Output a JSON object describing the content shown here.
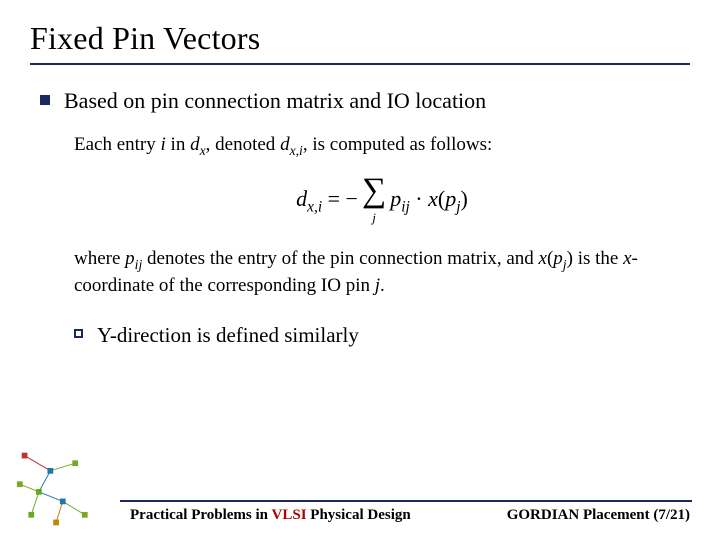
{
  "title": "Fixed Pin Vectors",
  "bullet1": "Based on pin connection matrix and IO location",
  "math": {
    "preline_a": "Each entry ",
    "i": "i",
    "preline_b": " in ",
    "dx": "d",
    "x": "x",
    "preline_c": ", denoted ",
    "dxi": "d",
    "xi": "x,i",
    "preline_d": ", is computed as follows:",
    "lhs_d": "d",
    "lhs_sub": "x,i",
    "eq": " = −",
    "sum_lower": "j",
    "p": "p",
    "ij": "ij",
    "cdot": " · ",
    "xfn": "x",
    "lp": "(",
    "pj_p": "p",
    "pj_j": "j",
    "rp": ")",
    "post_a": "where ",
    "post_p": "p",
    "post_ij": "ij",
    "post_b": " denotes the entry of the pin connection matrix, and ",
    "post_x": "x",
    "post_lp": "(",
    "post_pj_p": "p",
    "post_pj_j": "j",
    "post_rp": ")",
    "post_c": " is the ",
    "post_xcoord": "x",
    "post_d": "-coordinate of the corresponding IO pin ",
    "post_jj": "j",
    "post_e": "."
  },
  "bullet2": "Y-direction is defined similarly",
  "footer": {
    "left_a": "Practical Problems in ",
    "left_vlsi": "VLSI",
    "left_b": " Physical Design",
    "right": "GORDIAN Placement (7/21)"
  }
}
